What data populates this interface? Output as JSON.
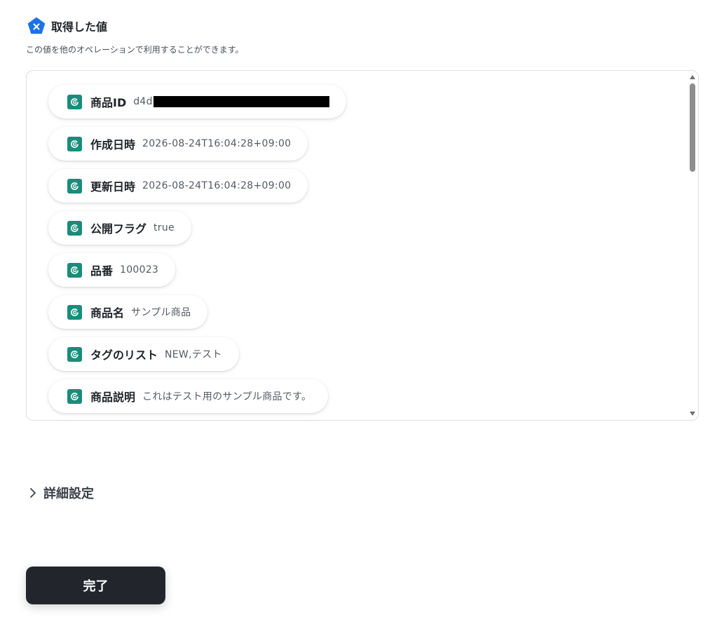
{
  "header": {
    "title": "取得した値",
    "description": "この値を他のオペレーションで利用することができます。"
  },
  "values": [
    {
      "label": "商品ID",
      "value": "d4d"
    },
    {
      "label": "作成日時",
      "value": "2026-08-24T16:04:28+09:00"
    },
    {
      "label": "更新日時",
      "value": "2026-08-24T16:04:28+09:00"
    },
    {
      "label": "公開フラグ",
      "value": "true"
    },
    {
      "label": "品番",
      "value": "100023"
    },
    {
      "label": "商品名",
      "value": "サンプル商品"
    },
    {
      "label": "タグのリスト",
      "value": "NEW,テスト"
    },
    {
      "label": "商品説明",
      "value": "これはテスト用のサンプル商品です。"
    }
  ],
  "details": {
    "label": "詳細設定"
  },
  "footer": {
    "done_label": "完了"
  },
  "colors": {
    "accent_blue": "#1a73e8",
    "chip_icon": "#1a8c7a",
    "button_bg": "#22262c"
  }
}
